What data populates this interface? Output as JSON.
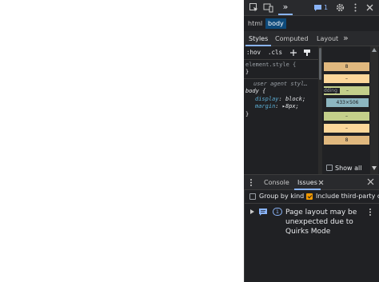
{
  "toolbar": {
    "more_tabs_label": "»",
    "issues_count": "1",
    "icons": [
      "inspect-icon",
      "device-toolbar-icon",
      "chevron-double-right-icon",
      "issues-icon",
      "gear-icon",
      "more-vert-icon",
      "close-icon"
    ]
  },
  "breadcrumbs": [
    "html",
    "body"
  ],
  "subtabs": {
    "styles": "Styles",
    "computed": "Computed",
    "layout": "Layout",
    "more": "»"
  },
  "filterbar": {
    "hov": ":hov",
    "cls": ".cls"
  },
  "styles_pane": {
    "element_style": "element.style {",
    "close_brace": "}",
    "ua_comment": "user agent styl…",
    "selector": "body {",
    "rules": [
      {
        "prop": "display",
        "value": "block;"
      },
      {
        "prop": "margin",
        "value": "8px;"
      }
    ]
  },
  "box_model": {
    "margin_top": "8",
    "border_top": "–",
    "padding_label": "dding",
    "padding_top": "–",
    "content_size": "433×506",
    "padding_bottom": "–",
    "border_bottom": "–",
    "margin_bottom": "8"
  },
  "show_all_label": "Show all",
  "drawer": {
    "tabs": {
      "console": "Console",
      "issues": "Issues"
    },
    "group_by_kind": "Group by kind",
    "include_third_party": "Include third-party co"
  },
  "issue": {
    "count": "1",
    "text": "Page layout may be unexpected due to Quirks Mode"
  },
  "colors": {
    "devtools_bg": "#202124",
    "accent": "#8ab4f8",
    "selected_crumb": "#0e4a7a",
    "margin_box": "#e0b87e",
    "border_box": "#fcd79a",
    "padding_box": "#c3cf8a",
    "content_box": "#8cb6c0",
    "checkbox_checked": "#f29900"
  }
}
